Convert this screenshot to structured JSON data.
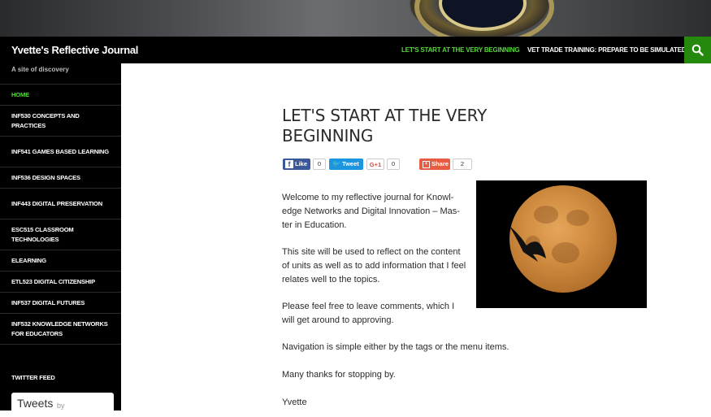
{
  "site": {
    "title": "Yvette's Reflective Journal",
    "tagline": "A site of discovery"
  },
  "topnav": {
    "items": [
      {
        "label": "LET'S START AT THE VERY BEGINNING",
        "active": true
      },
      {
        "label": "VET TRADE TRAINING: PREPARE TO BE SIMULATED."
      }
    ],
    "search_icon": "search-icon"
  },
  "sidebar": {
    "menu": [
      {
        "label": "HOME",
        "active": true
      },
      {
        "label": "INF530 CONCEPTS AND PRACTICES"
      },
      {
        "label": "INF541 GAMES BASED LEARNING"
      },
      {
        "label": "INF536 DESIGN SPACES"
      },
      {
        "label": "INF443 DIGITAL PRESERVATION"
      },
      {
        "label": "ESC515 CLASSROOM TECHNOLOGIES"
      },
      {
        "label": "ELEARNING"
      },
      {
        "label": "ETL523 DIGITAL CITIZENSHIP"
      },
      {
        "label": "INF537 DIGITAL FUTURES"
      },
      {
        "label": "INF532 KNOWLEDGE NETWORKS FOR EDUCATORS"
      }
    ],
    "twitter_title": "TWITTER FEED",
    "twitter_widget": {
      "title": "Tweets",
      "by": "by"
    }
  },
  "post": {
    "title": "LET'S START AT THE VERY BEGINNING",
    "share": {
      "like_label": "Like",
      "like_count": "0",
      "tweet_label": "Tweet",
      "gplus_label": "G+1",
      "gplus_count": "0",
      "share_label": "Share",
      "share_count": "2"
    },
    "paragraphs": [
      "Welcome to my reflective journal for Knowl-edge Networks and Digital Innovation – Mas-ter in Education.",
      "This site will be used to reflect on the content of units as well as to add information that I feel relates well to the topics.",
      "Please feel free to leave comments, which  I will get around to approving.",
      "Navigation is simple either by the tags or the menu items.",
      "Many thanks for stopping by.",
      "Yvette"
    ],
    "image_alt": "moon with bird silhouette"
  },
  "colors": {
    "accent": "#55d737",
    "search_bg": "#24890d",
    "header_bg": "#000000",
    "facebook": "#3b5998",
    "twitter": "#1b95e0",
    "share": "#e85c41"
  }
}
